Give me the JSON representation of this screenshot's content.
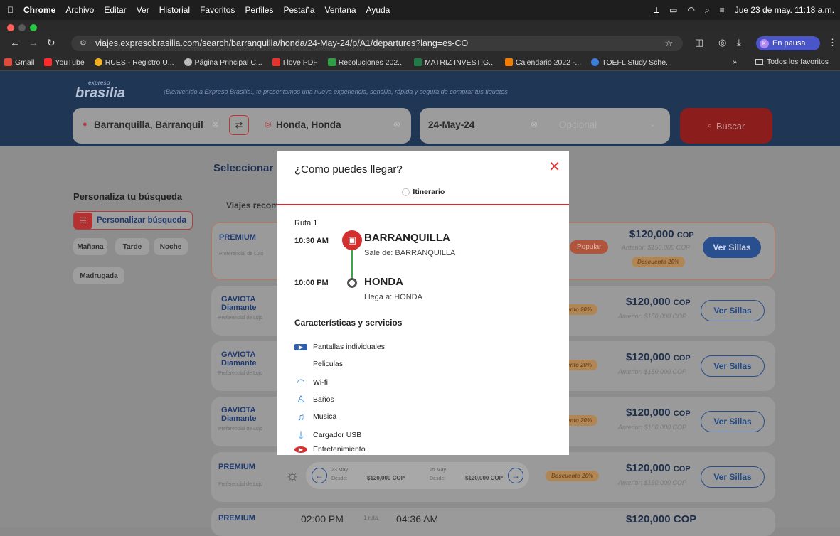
{
  "os_menu": {
    "items": [
      "Chrome",
      "Archivo",
      "Editar",
      "Ver",
      "Historial",
      "Favoritos",
      "Perfiles",
      "Pestaña",
      "Ventana",
      "Ayuda"
    ],
    "datetime": "Jue 23 de may.  11:18 a.m."
  },
  "browser": {
    "url": "viajes.expresobrasilia.com/search/barranquilla/honda/24-May-24/p/A1/departures?lang=es-CO",
    "profile_label": "En pausa",
    "profile_initial": "K",
    "bookmarks": [
      "Gmail",
      "YouTube",
      "RUES - Registro U...",
      "Página Principal C...",
      "I love PDF",
      "Resoluciones 202...",
      "MATRIZ INVESTIG...",
      "Calendario 2022 -...",
      "TOEFL Study Sche..."
    ],
    "bookmarks_more": "»",
    "all_bookmarks": "Todos los favoritos"
  },
  "site": {
    "logo_top": "expreso",
    "logo_main": "brasilia",
    "welcome": "¡Bienvenido a Expreso Brasilia!, te presentamos una nueva experiencia, sencilla, rápida y segura de comprar tus tiquetes",
    "origin": "Barranquilla, Barranquil",
    "destination": "Honda, Honda",
    "date": "24-May-24",
    "return_placeholder": "Opcional",
    "search_label": "Buscar",
    "select_heading": "Seleccionar",
    "personalize_heading": "Personaliza tu búsqueda",
    "personalize_button": "Personalizar búsqueda",
    "filters": [
      "Mañana",
      "Tarde",
      "Noche",
      "Madrugada"
    ],
    "recommended_label": "Viajes recom",
    "popular_badge": "Popular",
    "see_seats": "Ver Sillas",
    "price": "$120,000",
    "currency": "COP",
    "previous_price": "Anterior: $150,000 COP",
    "discount": "Descuento 20%",
    "discount_short": "ento 20%",
    "brands": {
      "premium": "PREMIUM",
      "premium_sub": "Preferencial de Lujo",
      "gaviota": "GAVIOTA",
      "gaviota_sub": "Diamante",
      "gaviota_sub2": "Preferencial de Lujo"
    },
    "date_nav": {
      "prev_date": "23 May",
      "next_date": "25 May",
      "from_label": "Desde:",
      "prev_price": "$120,000 COP",
      "next_price": "$120,000 COP"
    },
    "last_row": {
      "depart": "02:00 PM",
      "stops": "1 ruta",
      "arrive": "04:36 AM",
      "price": "$120,000 COP"
    }
  },
  "modal": {
    "title": "¿Como puedes llegar?",
    "tab_label": "Itinerario",
    "route_label": "Ruta 1",
    "departure_time": "10:30 AM",
    "departure_city": "BARRANQUILLA",
    "departure_detail": "Sale de: BARRANQUILLA",
    "arrival_time": "10:00 PM",
    "arrival_city": "HONDA",
    "arrival_detail": "Llega a: HONDA",
    "services_heading": "Características y servicios",
    "services": [
      "Pantallas individuales",
      "Peliculas",
      "Wi-fi",
      "Baños",
      "Musica",
      "Cargador USB",
      "Entretenimiento"
    ]
  },
  "colors": {
    "brand_red": "#d32f2f",
    "brand_blue": "#1f3a70",
    "route_green": "#3aa84a"
  }
}
